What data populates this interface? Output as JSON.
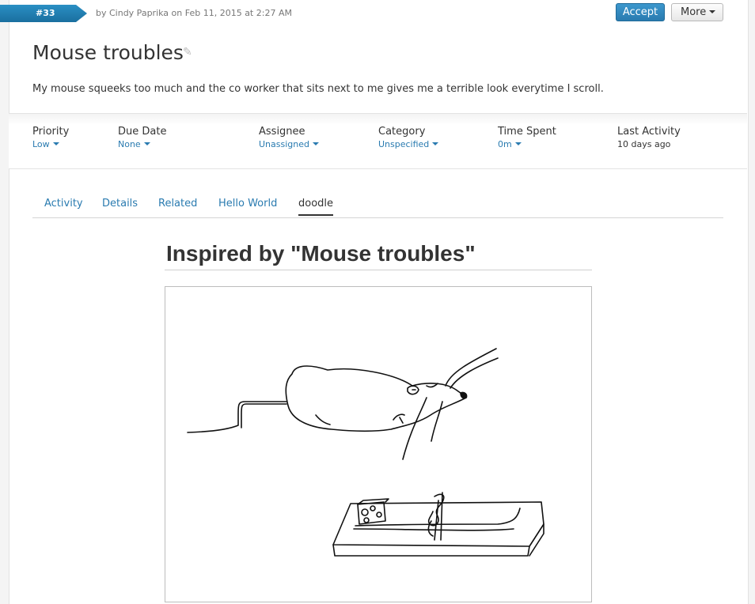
{
  "ticket": {
    "id": "#33",
    "byline": "by Cindy Paprika on Feb 11, 2015 at 2:27 AM",
    "title": "Mouse troubles",
    "description": "My mouse squeeks too much and the co worker that sits next to me gives me a terrible look everytime I scroll."
  },
  "actions": {
    "accept_label": "Accept",
    "more_label": "More"
  },
  "meta": {
    "priority": {
      "label": "Priority",
      "value": "Low"
    },
    "due_date": {
      "label": "Due Date",
      "value": "None"
    },
    "assignee": {
      "label": "Assignee",
      "value": "Unassigned"
    },
    "category": {
      "label": "Category",
      "value": "Unspecified"
    },
    "time_spent": {
      "label": "Time Spent",
      "value": "0m"
    },
    "last_activity": {
      "label": "Last Activity",
      "value": "10 days ago"
    }
  },
  "tabs": [
    {
      "label": "Activity"
    },
    {
      "label": "Details"
    },
    {
      "label": "Related"
    },
    {
      "label": "Hello World"
    },
    {
      "label": "doodle",
      "active": true
    }
  ],
  "doodle": {
    "heading": "Inspired by \"Mouse troubles\""
  },
  "colors": {
    "accent": "#2a7bb0",
    "badge": "#1f86bd"
  }
}
